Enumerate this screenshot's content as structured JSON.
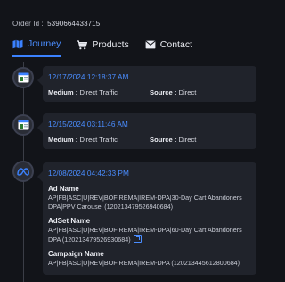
{
  "order": {
    "label": "Order Id :",
    "id": "5390664433715"
  },
  "tabs": [
    {
      "label": "Journey",
      "icon": "map-icon",
      "active": true
    },
    {
      "label": "Products",
      "icon": "cart-icon",
      "active": false
    },
    {
      "label": "Contact",
      "icon": "envelope-icon",
      "active": false
    }
  ],
  "timeline": [
    {
      "icon": "browser-icon",
      "date": "12/17/2024 12:18:37 AM",
      "medium_label": "Medium :",
      "medium": "Direct Traffic",
      "source_label": "Source :",
      "source": "Direct"
    },
    {
      "icon": "browser-icon",
      "date": "12/15/2024 03:11:46 AM",
      "medium_label": "Medium :",
      "medium": "Direct Traffic",
      "source_label": "Source :",
      "source": "Direct"
    },
    {
      "icon": "meta-icon",
      "date": "12/08/2024 04:42:33 PM",
      "ad_name_label": "Ad Name",
      "ad_name": "AP|FB|ASC|U|REV|BOF|REMA|IREM-DPA|30-Day Cart Abandoners DPA|PPV Carousel (120213479526940684)",
      "adset_name_label": "AdSet Name",
      "adset_name": "AP|FB|ASC|U|REV|BOF|REMA|IREM-DPA|60-Day Cart Abandoners DPA (120213479526930684)",
      "campaign_name_label": "Campaign Name",
      "campaign_name": "AP|FB|ASC|U|REV|BOF|REMA|IREM-DPA (120213445612800684)"
    }
  ],
  "colors": {
    "background": "#121419",
    "card": "#20232b",
    "accent": "#3b82ff"
  }
}
